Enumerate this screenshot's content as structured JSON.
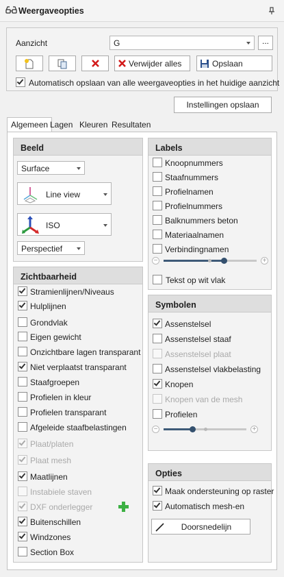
{
  "title": "Weergaveopties",
  "view": {
    "label": "Aanzicht",
    "value": "G",
    "more": "...",
    "delete_all": "Verwijder alles",
    "save": "Opslaan",
    "autosave": "Automatisch opslaan van alle weergaveopties in het huidige aanzicht",
    "save_settings": "Instellingen opslaan"
  },
  "tabs": [
    "Algemeen",
    "Lagen",
    "Kleuren",
    "Resultaten"
  ],
  "beeld": {
    "header": "Beeld",
    "render_mode": "Surface",
    "line_view": "Line view",
    "iso": "ISO",
    "projection": "Perspectief"
  },
  "zichtbaarheid": {
    "header": "Zichtbaarheid",
    "items": [
      {
        "label": "Stramienlijnen/Niveaus",
        "checked": true,
        "disabled": false
      },
      {
        "label": "Hulplijnen",
        "checked": true,
        "disabled": false
      },
      {
        "label": "Grondvlak",
        "checked": false,
        "disabled": false
      },
      {
        "label": "Eigen gewicht",
        "checked": false,
        "disabled": false
      },
      {
        "label": "Onzichtbare lagen transparant",
        "checked": false,
        "disabled": false
      },
      {
        "label": "Niet verplaatst transparant",
        "checked": true,
        "disabled": false
      },
      {
        "label": "Staafgroepen",
        "checked": false,
        "disabled": false
      },
      {
        "label": "Profielen in kleur",
        "checked": false,
        "disabled": false
      },
      {
        "label": "Profielen transparant",
        "checked": false,
        "disabled": false
      },
      {
        "label": "Afgeleide staafbelastingen",
        "checked": false,
        "disabled": false
      },
      {
        "label": "Plaat/platen",
        "checked": true,
        "disabled": true
      },
      {
        "label": "Plaat mesh",
        "checked": true,
        "disabled": true
      },
      {
        "label": "Maatlijnen",
        "checked": true,
        "disabled": false
      },
      {
        "label": "Instabiele staven",
        "checked": false,
        "disabled": true
      },
      {
        "label": "DXF onderlegger",
        "checked": true,
        "disabled": true
      },
      {
        "label": "Buitenschillen",
        "checked": true,
        "disabled": false
      },
      {
        "label": "Windzones",
        "checked": true,
        "disabled": false
      },
      {
        "label": "Section Box",
        "checked": false,
        "disabled": false
      }
    ]
  },
  "labels": {
    "header": "Labels",
    "items": [
      {
        "label": "Knoopnummers",
        "checked": false
      },
      {
        "label": "Staafnummers",
        "checked": false
      },
      {
        "label": "Profielnamen",
        "checked": false
      },
      {
        "label": "Profielnummers",
        "checked": false
      },
      {
        "label": "Balknummers beton",
        "checked": false
      },
      {
        "label": "Materiaalnamen",
        "checked": false
      },
      {
        "label": "Verbindingnamen",
        "checked": false
      }
    ],
    "slider_fraction": 0.65,
    "text_on_white": "Tekst op wit vlak"
  },
  "symbolen": {
    "header": "Symbolen",
    "items": [
      {
        "label": "Assenstelsel",
        "checked": true,
        "disabled": false
      },
      {
        "label": "Assenstelsel staaf",
        "checked": false,
        "disabled": false
      },
      {
        "label": "Assenstelsel plaat",
        "checked": false,
        "disabled": true
      },
      {
        "label": "Assenstelsel vlakbelasting",
        "checked": false,
        "disabled": false
      },
      {
        "label": "Knopen",
        "checked": true,
        "disabled": false
      },
      {
        "label": "Knopen van de mesh",
        "checked": false,
        "disabled": true
      },
      {
        "label": "Profielen",
        "checked": false,
        "disabled": false
      }
    ],
    "slider_fraction": 0.35
  },
  "opties": {
    "header": "Opties",
    "items": [
      {
        "label": "Maak ondersteuning op raster",
        "checked": true
      },
      {
        "label": "Automatisch mesh-en",
        "checked": true
      }
    ],
    "section_line": "Doorsnedelijn"
  },
  "colors": {
    "accent": "#34506e",
    "delete_red": "#d31a1a",
    "add_green": "#3cb043",
    "header_bg": "#dedede"
  },
  "icons": [
    "glasses-icon",
    "pin-icon",
    "new-view-icon",
    "copy-view-icon",
    "delete-x-icon",
    "save-disk-icon",
    "line-view-icon",
    "axes-icon",
    "add-plus-icon",
    "minus-icon",
    "plus-icon",
    "section-line-icon"
  ]
}
